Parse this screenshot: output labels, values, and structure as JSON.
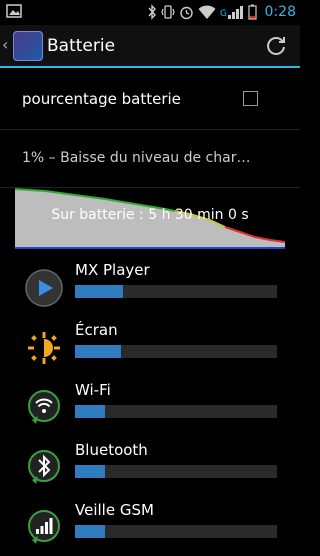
{
  "status_bar": {
    "time": "0:28"
  },
  "action_bar": {
    "back_glyph": "‹",
    "title": "Batterie"
  },
  "settings": {
    "percentage_label": "pourcentage batterie",
    "percentage_checked": false
  },
  "battery_status": "1% – Baisse du niveau de char…",
  "graph": {
    "caption": "Sur batterie : 5 h 30 min 0 s",
    "line_colors": [
      "#33aa33",
      "#c8c832",
      "#e03030"
    ]
  },
  "usage": [
    {
      "name": "MX Player",
      "icon": "play-icon",
      "share": 0.24
    },
    {
      "name": "Écran",
      "icon": "brightness-icon",
      "share": 0.23
    },
    {
      "name": "Wi-Fi",
      "icon": "wifi-icon",
      "share": 0.15
    },
    {
      "name": "Bluetooth",
      "icon": "bluetooth-icon",
      "share": 0.15
    },
    {
      "name": "Veille GSM",
      "icon": "cell-signal-icon",
      "share": 0.15
    }
  ]
}
